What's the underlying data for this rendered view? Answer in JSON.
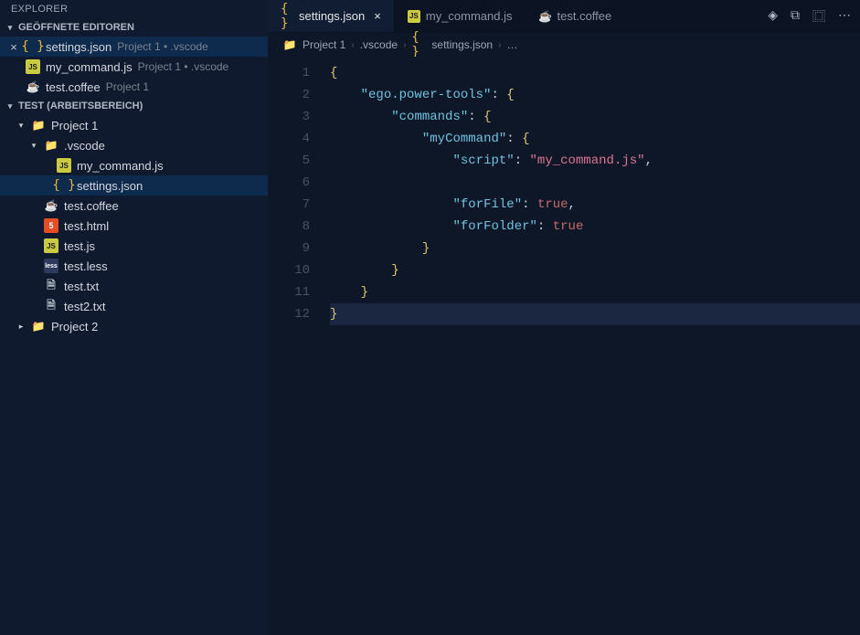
{
  "explorer": {
    "title": "EXPLORER",
    "openEditorsTitle": "GEÖFFNETE EDITOREN",
    "openEditors": [
      {
        "icon": "json",
        "name": "settings.json",
        "sub": "Project 1 • .vscode",
        "active": true
      },
      {
        "icon": "js",
        "name": "my_command.js",
        "sub": "Project 1 • .vscode",
        "active": false
      },
      {
        "icon": "coffee",
        "name": "test.coffee",
        "sub": "Project 1",
        "active": false
      }
    ],
    "workspaceTitle": "TEST (ARBEITSBEREICH)",
    "tree": [
      {
        "depth": 0,
        "kind": "folder-root",
        "name": "Project 1",
        "open": true
      },
      {
        "depth": 1,
        "kind": "folder-vscode",
        "name": ".vscode",
        "open": true
      },
      {
        "depth": 2,
        "kind": "js",
        "name": "my_command.js"
      },
      {
        "depth": 2,
        "kind": "json",
        "name": "settings.json",
        "selected": true
      },
      {
        "depth": 1,
        "kind": "coffee",
        "name": "test.coffee"
      },
      {
        "depth": 1,
        "kind": "html",
        "name": "test.html"
      },
      {
        "depth": 1,
        "kind": "js",
        "name": "test.js"
      },
      {
        "depth": 1,
        "kind": "less",
        "name": "test.less"
      },
      {
        "depth": 1,
        "kind": "txt",
        "name": "test.txt"
      },
      {
        "depth": 1,
        "kind": "txt",
        "name": "test2.txt"
      },
      {
        "depth": 0,
        "kind": "folder-root",
        "name": "Project 2",
        "open": false
      }
    ]
  },
  "tabs": [
    {
      "icon": "json",
      "label": "settings.json",
      "active": true,
      "closeable": true
    },
    {
      "icon": "js",
      "label": "my_command.js",
      "active": false,
      "closeable": false
    },
    {
      "icon": "coffee",
      "label": "test.coffee",
      "active": false,
      "closeable": false
    }
  ],
  "titleActions": [
    "◈",
    "⧉",
    "⿴",
    "⋯"
  ],
  "breadcrumb": [
    {
      "icon": "folder",
      "text": "Project 1"
    },
    {
      "text": ".vscode"
    },
    {
      "icon": "json",
      "text": "settings.json"
    },
    {
      "text": "…"
    }
  ],
  "editorContent": {
    "lineCount": 12,
    "json": {
      "ego.power-tools": {
        "commands": {
          "myCommand": {
            "script": "my_command.js",
            "forFile": true,
            "forFolder": true
          }
        }
      }
    },
    "lines": [
      {
        "n": 1,
        "raw": "{",
        "cls": ""
      },
      {
        "n": 2,
        "raw": "    \"ego.power-tools\": {",
        "cls": ""
      },
      {
        "n": 3,
        "raw": "        \"commands\": {",
        "cls": ""
      },
      {
        "n": 4,
        "raw": "            \"myCommand\": {",
        "cls": ""
      },
      {
        "n": 5,
        "raw": "                \"script\": \"my_command.js\",",
        "cls": ""
      },
      {
        "n": 6,
        "raw": "",
        "cls": ""
      },
      {
        "n": 7,
        "raw": "                \"forFile\": true,",
        "cls": ""
      },
      {
        "n": 8,
        "raw": "                \"forFolder\": true",
        "cls": ""
      },
      {
        "n": 9,
        "raw": "            }",
        "cls": ""
      },
      {
        "n": 10,
        "raw": "        }",
        "cls": ""
      },
      {
        "n": 11,
        "raw": "    }",
        "cls": ""
      },
      {
        "n": 12,
        "raw": "}",
        "cls": "current"
      }
    ]
  },
  "iconGlyph": {
    "json": "{ }",
    "js": "JS",
    "coffee": "☕",
    "folder": "📁",
    "folder-root": "📁",
    "folder-vscode": "📁",
    "html": "5",
    "less": "less",
    "txt": "🗎"
  }
}
